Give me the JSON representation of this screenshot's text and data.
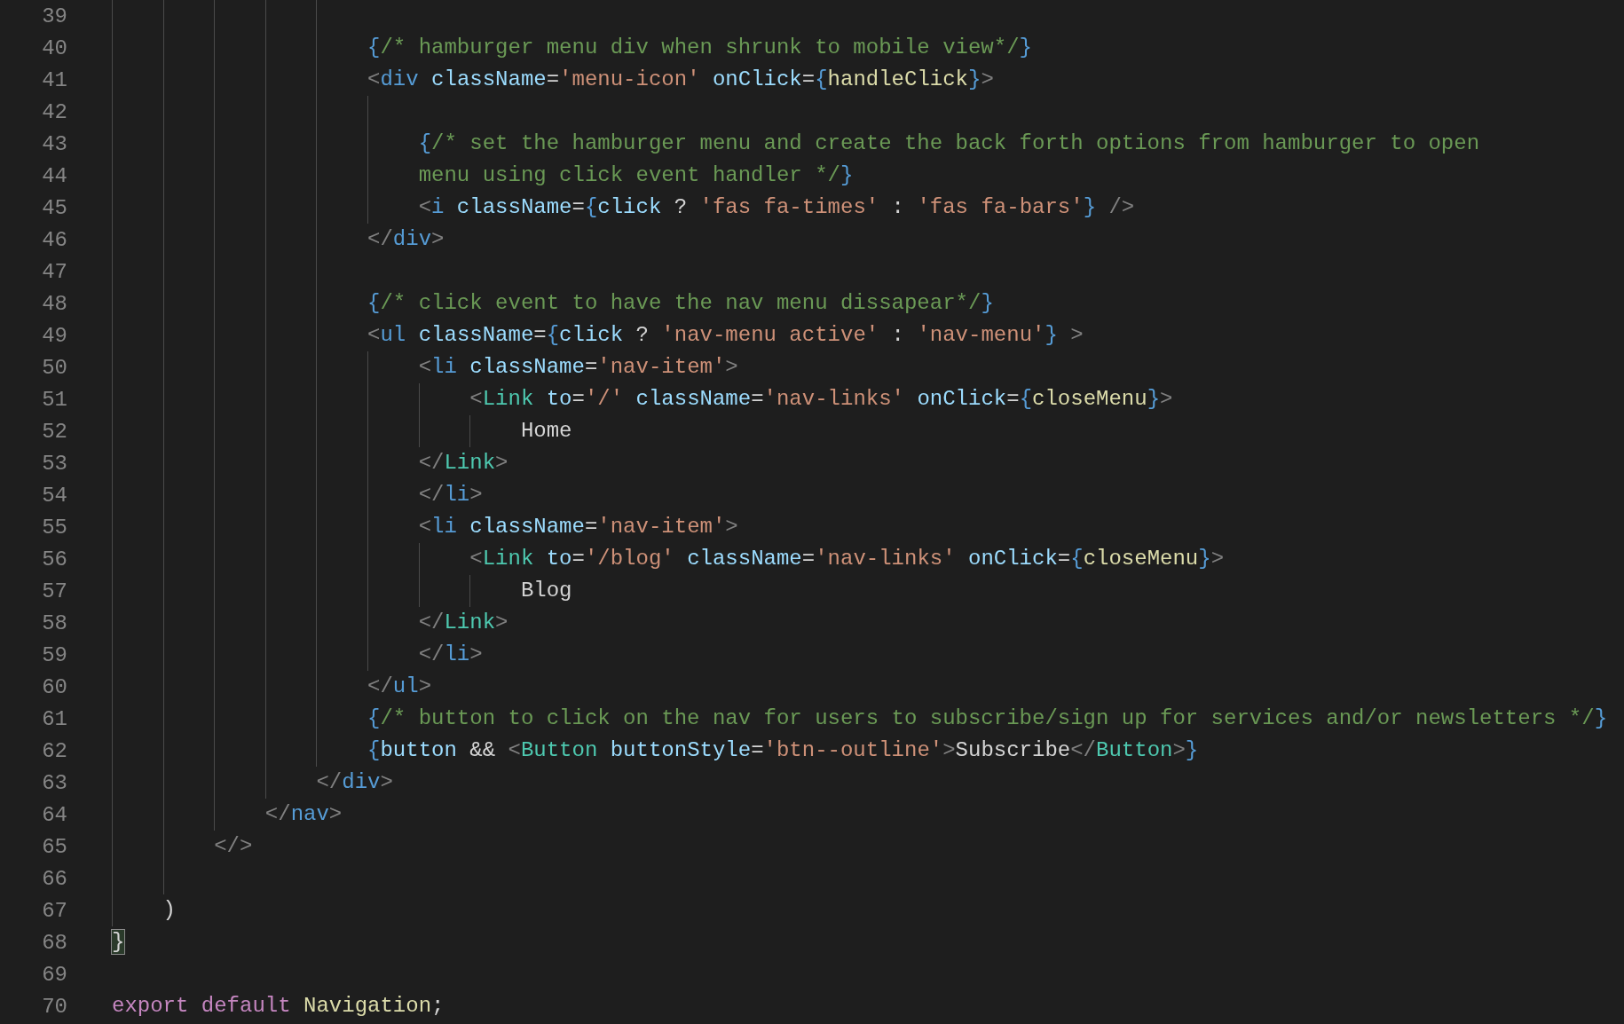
{
  "editor": {
    "lines": [
      {
        "children": [
          {
            "children": [
              {
                "children": [
                  {
                    "children": [
                      {
                        "children": [
                          {
                            "number": "39"
                          },
                          {
                            "number": "40",
                            "tokens": [
                              {
                                "kind": "brace",
                                "text": "{"
                              },
                              {
                                "kind": "comment",
                                "text": "/* hamburger menu div when shrunk to mobile view*/"
                              },
                              {
                                "kind": "brace",
                                "text": "}"
                              }
                            ]
                          },
                          {
                            "number": "41",
                            "tokens": [
                              {
                                "kind": "punct",
                                "text": "<"
                              },
                              {
                                "kind": "tag",
                                "text": "div"
                              },
                              {
                                "kind": "attr",
                                "text": " className"
                              },
                              {
                                "kind": "plain",
                                "text": "="
                              },
                              {
                                "kind": "string",
                                "text": "'menu-icon'"
                              },
                              {
                                "kind": "attr",
                                "text": " onClick"
                              },
                              {
                                "kind": "plain",
                                "text": "="
                              },
                              {
                                "kind": "brace",
                                "text": "{"
                              },
                              {
                                "kind": "func",
                                "text": "handleClick"
                              },
                              {
                                "kind": "brace",
                                "text": "}"
                              },
                              {
                                "kind": "punct",
                                "text": ">"
                              }
                            ],
                            "children": [
                              {
                                "number": "42"
                              },
                              {
                                "number": "43",
                                "tokens": [
                                  {
                                    "kind": "brace",
                                    "text": "{"
                                  },
                                  {
                                    "kind": "comment",
                                    "text": "/* set the hamburger menu and create the back forth options from hamburger to open"
                                  }
                                ]
                              },
                              {
                                "number": "44",
                                "tokens": [
                                  {
                                    "kind": "comment",
                                    "text": "menu using click event handler */"
                                  },
                                  {
                                    "kind": "brace",
                                    "text": "}"
                                  }
                                ]
                              },
                              {
                                "number": "45",
                                "tokens": [
                                  {
                                    "kind": "punct",
                                    "text": "<"
                                  },
                                  {
                                    "kind": "tag",
                                    "text": "i"
                                  },
                                  {
                                    "kind": "attr",
                                    "text": " className"
                                  },
                                  {
                                    "kind": "plain",
                                    "text": "="
                                  },
                                  {
                                    "kind": "brace",
                                    "text": "{"
                                  },
                                  {
                                    "kind": "variable",
                                    "text": "click"
                                  },
                                  {
                                    "kind": "plain",
                                    "text": " ? "
                                  },
                                  {
                                    "kind": "string",
                                    "text": "'fas fa-times'"
                                  },
                                  {
                                    "kind": "plain",
                                    "text": " : "
                                  },
                                  {
                                    "kind": "string",
                                    "text": "'fas fa-bars'"
                                  },
                                  {
                                    "kind": "brace",
                                    "text": "}"
                                  },
                                  {
                                    "kind": "punct",
                                    "text": " />"
                                  }
                                ]
                              }
                            ]
                          },
                          {
                            "number": "46",
                            "tokens": [
                              {
                                "kind": "punct",
                                "text": "</"
                              },
                              {
                                "kind": "tag",
                                "text": "div"
                              },
                              {
                                "kind": "punct",
                                "text": ">"
                              }
                            ]
                          },
                          {
                            "number": "47"
                          },
                          {
                            "number": "48",
                            "tokens": [
                              {
                                "kind": "brace",
                                "text": "{"
                              },
                              {
                                "kind": "comment",
                                "text": "/* click event to have the nav menu dissapear*/"
                              },
                              {
                                "kind": "brace",
                                "text": "}"
                              }
                            ]
                          },
                          {
                            "number": "49",
                            "tokens": [
                              {
                                "kind": "punct",
                                "text": "<"
                              },
                              {
                                "kind": "tag",
                                "text": "ul"
                              },
                              {
                                "kind": "attr",
                                "text": " className"
                              },
                              {
                                "kind": "plain",
                                "text": "="
                              },
                              {
                                "kind": "brace",
                                "text": "{"
                              },
                              {
                                "kind": "variable",
                                "text": "click"
                              },
                              {
                                "kind": "plain",
                                "text": " ? "
                              },
                              {
                                "kind": "string",
                                "text": "'nav-menu active'"
                              },
                              {
                                "kind": "plain",
                                "text": " : "
                              },
                              {
                                "kind": "string",
                                "text": "'nav-menu'"
                              },
                              {
                                "kind": "brace",
                                "text": "}"
                              },
                              {
                                "kind": "punct",
                                "text": " >"
                              }
                            ],
                            "children": [
                              {
                                "number": "50",
                                "tokens": [
                                  {
                                    "kind": "punct",
                                    "text": "<"
                                  },
                                  {
                                    "kind": "tag",
                                    "text": "li"
                                  },
                                  {
                                    "kind": "attr",
                                    "text": " className"
                                  },
                                  {
                                    "kind": "plain",
                                    "text": "="
                                  },
                                  {
                                    "kind": "string",
                                    "text": "'nav-item'"
                                  },
                                  {
                                    "kind": "punct",
                                    "text": ">"
                                  }
                                ],
                                "children": [
                                  {
                                    "number": "51",
                                    "tokens": [
                                      {
                                        "kind": "punct",
                                        "text": "<"
                                      },
                                      {
                                        "kind": "component",
                                        "text": "Link"
                                      },
                                      {
                                        "kind": "attr",
                                        "text": " to"
                                      },
                                      {
                                        "kind": "plain",
                                        "text": "="
                                      },
                                      {
                                        "kind": "string",
                                        "text": "'/'"
                                      },
                                      {
                                        "kind": "attr",
                                        "text": " className"
                                      },
                                      {
                                        "kind": "plain",
                                        "text": "="
                                      },
                                      {
                                        "kind": "string",
                                        "text": "'nav-links'"
                                      },
                                      {
                                        "kind": "attr",
                                        "text": " onClick"
                                      },
                                      {
                                        "kind": "plain",
                                        "text": "="
                                      },
                                      {
                                        "kind": "brace",
                                        "text": "{"
                                      },
                                      {
                                        "kind": "func",
                                        "text": "closeMenu"
                                      },
                                      {
                                        "kind": "brace",
                                        "text": "}"
                                      },
                                      {
                                        "kind": "punct",
                                        "text": ">"
                                      }
                                    ],
                                    "children": [
                                      {
                                        "number": "52",
                                        "tokens": [
                                          {
                                            "kind": "plain",
                                            "text": "Home"
                                          }
                                        ]
                                      }
                                    ]
                                  }
                                ]
                              },
                              {
                                "number": "53",
                                "tokens": [
                                  {
                                    "kind": "punct",
                                    "text": "</"
                                  },
                                  {
                                    "kind": "component",
                                    "text": "Link"
                                  },
                                  {
                                    "kind": "punct",
                                    "text": ">"
                                  }
                                ]
                              },
                              {
                                "number": "54",
                                "tokens": [
                                  {
                                    "kind": "punct",
                                    "text": "</"
                                  },
                                  {
                                    "kind": "tag",
                                    "text": "li"
                                  },
                                  {
                                    "kind": "punct",
                                    "text": ">"
                                  }
                                ]
                              },
                              {
                                "number": "55",
                                "tokens": [
                                  {
                                    "kind": "punct",
                                    "text": "<"
                                  },
                                  {
                                    "kind": "tag",
                                    "text": "li"
                                  },
                                  {
                                    "kind": "attr",
                                    "text": " className"
                                  },
                                  {
                                    "kind": "plain",
                                    "text": "="
                                  },
                                  {
                                    "kind": "string",
                                    "text": "'nav-item'"
                                  },
                                  {
                                    "kind": "punct",
                                    "text": ">"
                                  }
                                ],
                                "children": [
                                  {
                                    "number": "56",
                                    "tokens": [
                                      {
                                        "kind": "punct",
                                        "text": "<"
                                      },
                                      {
                                        "kind": "component",
                                        "text": "Link"
                                      },
                                      {
                                        "kind": "attr",
                                        "text": " to"
                                      },
                                      {
                                        "kind": "plain",
                                        "text": "="
                                      },
                                      {
                                        "kind": "string",
                                        "text": "'/blog'"
                                      },
                                      {
                                        "kind": "attr",
                                        "text": " className"
                                      },
                                      {
                                        "kind": "plain",
                                        "text": "="
                                      },
                                      {
                                        "kind": "string",
                                        "text": "'nav-links'"
                                      },
                                      {
                                        "kind": "attr",
                                        "text": " onClick"
                                      },
                                      {
                                        "kind": "plain",
                                        "text": "="
                                      },
                                      {
                                        "kind": "brace",
                                        "text": "{"
                                      },
                                      {
                                        "kind": "func",
                                        "text": "closeMenu"
                                      },
                                      {
                                        "kind": "brace",
                                        "text": "}"
                                      },
                                      {
                                        "kind": "punct",
                                        "text": ">"
                                      }
                                    ],
                                    "children": [
                                      {
                                        "number": "57",
                                        "tokens": [
                                          {
                                            "kind": "plain",
                                            "text": "Blog"
                                          }
                                        ]
                                      }
                                    ]
                                  }
                                ]
                              },
                              {
                                "number": "58",
                                "tokens": [
                                  {
                                    "kind": "punct",
                                    "text": "</"
                                  },
                                  {
                                    "kind": "component",
                                    "text": "Link"
                                  },
                                  {
                                    "kind": "punct",
                                    "text": ">"
                                  }
                                ]
                              },
                              {
                                "number": "59",
                                "tokens": [
                                  {
                                    "kind": "punct",
                                    "text": "</"
                                  },
                                  {
                                    "kind": "tag",
                                    "text": "li"
                                  },
                                  {
                                    "kind": "punct",
                                    "text": ">"
                                  }
                                ]
                              }
                            ]
                          },
                          {
                            "number": "60",
                            "tokens": [
                              {
                                "kind": "punct",
                                "text": "</"
                              },
                              {
                                "kind": "tag",
                                "text": "ul"
                              },
                              {
                                "kind": "punct",
                                "text": ">"
                              }
                            ]
                          },
                          {
                            "number": "61",
                            "tokens": [
                              {
                                "kind": "brace",
                                "text": "{"
                              },
                              {
                                "kind": "comment",
                                "text": "/* button to click on the nav for users to subscribe/sign up for services and/or newsletters */"
                              },
                              {
                                "kind": "brace",
                                "text": "}"
                              }
                            ]
                          },
                          {
                            "number": "62",
                            "tokens": [
                              {
                                "kind": "brace",
                                "text": "{"
                              },
                              {
                                "kind": "variable",
                                "text": "button"
                              },
                              {
                                "kind": "plain",
                                "text": " && "
                              },
                              {
                                "kind": "punct",
                                "text": "<"
                              },
                              {
                                "kind": "component",
                                "text": "Button"
                              },
                              {
                                "kind": "attr",
                                "text": " buttonStyle"
                              },
                              {
                                "kind": "plain",
                                "text": "="
                              },
                              {
                                "kind": "string",
                                "text": "'btn--outline'"
                              },
                              {
                                "kind": "punct",
                                "text": ">"
                              },
                              {
                                "kind": "plain",
                                "text": "Subscribe"
                              },
                              {
                                "kind": "punct",
                                "text": "</"
                              },
                              {
                                "kind": "component",
                                "text": "Button"
                              },
                              {
                                "kind": "punct",
                                "text": ">"
                              },
                              {
                                "kind": "brace",
                                "text": "}"
                              }
                            ]
                          }
                        ]
                      },
                      {
                        "number": "63",
                        "tokens": [
                          {
                            "kind": "punct",
                            "text": "</"
                          },
                          {
                            "kind": "tag",
                            "text": "div"
                          },
                          {
                            "kind": "punct",
                            "text": ">"
                          }
                        ]
                      }
                    ]
                  },
                  {
                    "number": "64",
                    "tokens": [
                      {
                        "kind": "punct",
                        "text": "</"
                      },
                      {
                        "kind": "tag",
                        "text": "nav"
                      },
                      {
                        "kind": "punct",
                        "text": ">"
                      }
                    ]
                  }
                ]
              },
              {
                "number": "65",
                "tokens": [
                  {
                    "kind": "punct",
                    "text": "</>"
                  }
                ]
              },
              {
                "number": "66"
              }
            ]
          },
          {
            "number": "67",
            "tokens": [
              {
                "kind": "plain",
                "text": ")"
              }
            ]
          }
        ]
      },
      {
        "number": "68",
        "tokens": [
          {
            "kind": "bracket-match",
            "text": "}"
          }
        ]
      },
      {
        "number": "69"
      },
      {
        "number": "70",
        "tokens": [
          {
            "kind": "keyword",
            "text": "export default"
          },
          {
            "kind": "func",
            "text": " Navigation"
          },
          {
            "kind": "plain",
            "text": ";"
          }
        ]
      }
    ]
  }
}
